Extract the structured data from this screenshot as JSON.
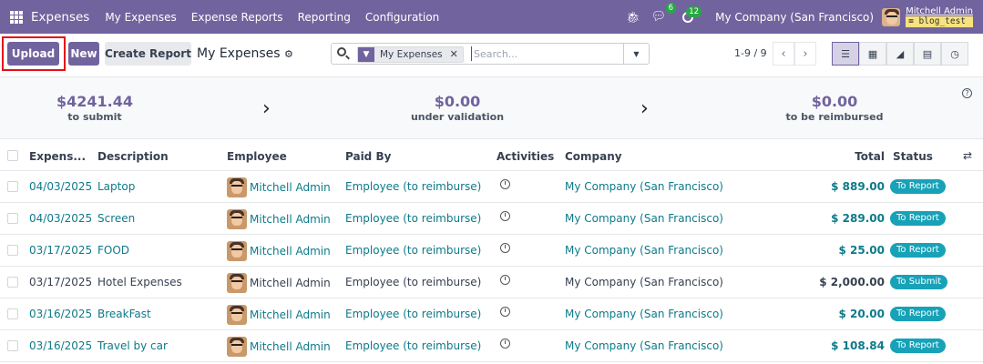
{
  "navbar": {
    "app_title": "Expenses",
    "menu": [
      "My Expenses",
      "Expense Reports",
      "Reporting",
      "Configuration"
    ],
    "chat_badge": "6",
    "activity_badge": "12",
    "company": "My Company (San Francisco)",
    "user_name": "Mitchell Admin",
    "db_name": "blog_test"
  },
  "control_panel": {
    "upload_label": "Upload",
    "new_label": "New",
    "create_report_label": "Create Report",
    "view_title": "My Expenses",
    "search": {
      "facet_label": "My Expenses",
      "placeholder": "Search..."
    },
    "pager": "1-9 / 9"
  },
  "dashboard": {
    "to_submit_value": "$4241.44",
    "to_submit_label": "to submit",
    "under_validation_value": "$0.00",
    "under_validation_label": "under validation",
    "to_be_reimbursed_value": "$0.00",
    "to_be_reimbursed_label": "to be reimbursed"
  },
  "table": {
    "headers": {
      "date": "Expens...",
      "description": "Description",
      "employee": "Employee",
      "paid_by": "Paid By",
      "activities": "Activities",
      "company": "Company",
      "total": "Total",
      "status": "Status"
    },
    "rows": [
      {
        "date": "04/03/2025",
        "description": "Laptop",
        "employee": "Mitchell Admin",
        "paid_by": "Employee (to reimburse)",
        "company": "My Company (San Francisco)",
        "total": "$ 889.00",
        "status": "To Report"
      },
      {
        "date": "04/03/2025",
        "description": "Screen",
        "employee": "Mitchell Admin",
        "paid_by": "Employee (to reimburse)",
        "company": "My Company (San Francisco)",
        "total": "$ 289.00",
        "status": "To Report"
      },
      {
        "date": "03/17/2025",
        "description": "FOOD",
        "employee": "Mitchell Admin",
        "paid_by": "Employee (to reimburse)",
        "company": "My Company (San Francisco)",
        "total": "$ 25.00",
        "status": "To Report"
      },
      {
        "date": "03/17/2025",
        "description": "Hotel Expenses",
        "employee": "Mitchell Admin",
        "paid_by": "Employee (to reimburse)",
        "company": "My Company (San Francisco)",
        "total": "$ 2,000.00",
        "status": "To Submit"
      },
      {
        "date": "03/16/2025",
        "description": "BreakFast",
        "employee": "Mitchell Admin",
        "paid_by": "Employee (to reimburse)",
        "company": "My Company (San Francisco)",
        "total": "$ 20.00",
        "status": "To Report"
      },
      {
        "date": "03/16/2025",
        "description": "Travel by car",
        "employee": "Mitchell Admin",
        "paid_by": "Employee (to reimburse)",
        "company": "My Company (San Francisco)",
        "total": "$ 108.84",
        "status": "To Report"
      }
    ]
  },
  "colors": {
    "brand": "#71639e",
    "link": "#0d7a8a",
    "status": "#17a2b8",
    "highlight": "#e3101a"
  }
}
